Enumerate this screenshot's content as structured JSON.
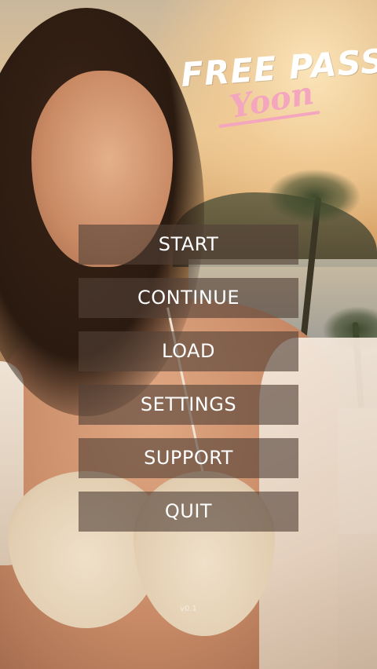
{
  "logo": {
    "title": "FREE PASS",
    "subtitle": "Yoon",
    "title_color": "#ffffff",
    "subtitle_color": "#f3a6bd"
  },
  "menu": {
    "items": [
      {
        "label": "START"
      },
      {
        "label": "CONTINUE"
      },
      {
        "label": "LOAD"
      },
      {
        "label": "SETTINGS"
      },
      {
        "label": "SUPPORT"
      },
      {
        "label": "QUIT"
      }
    ],
    "button_background": "rgba(82,64,55,0.62)",
    "text_color": "#ffffff"
  },
  "version": "v0.1"
}
